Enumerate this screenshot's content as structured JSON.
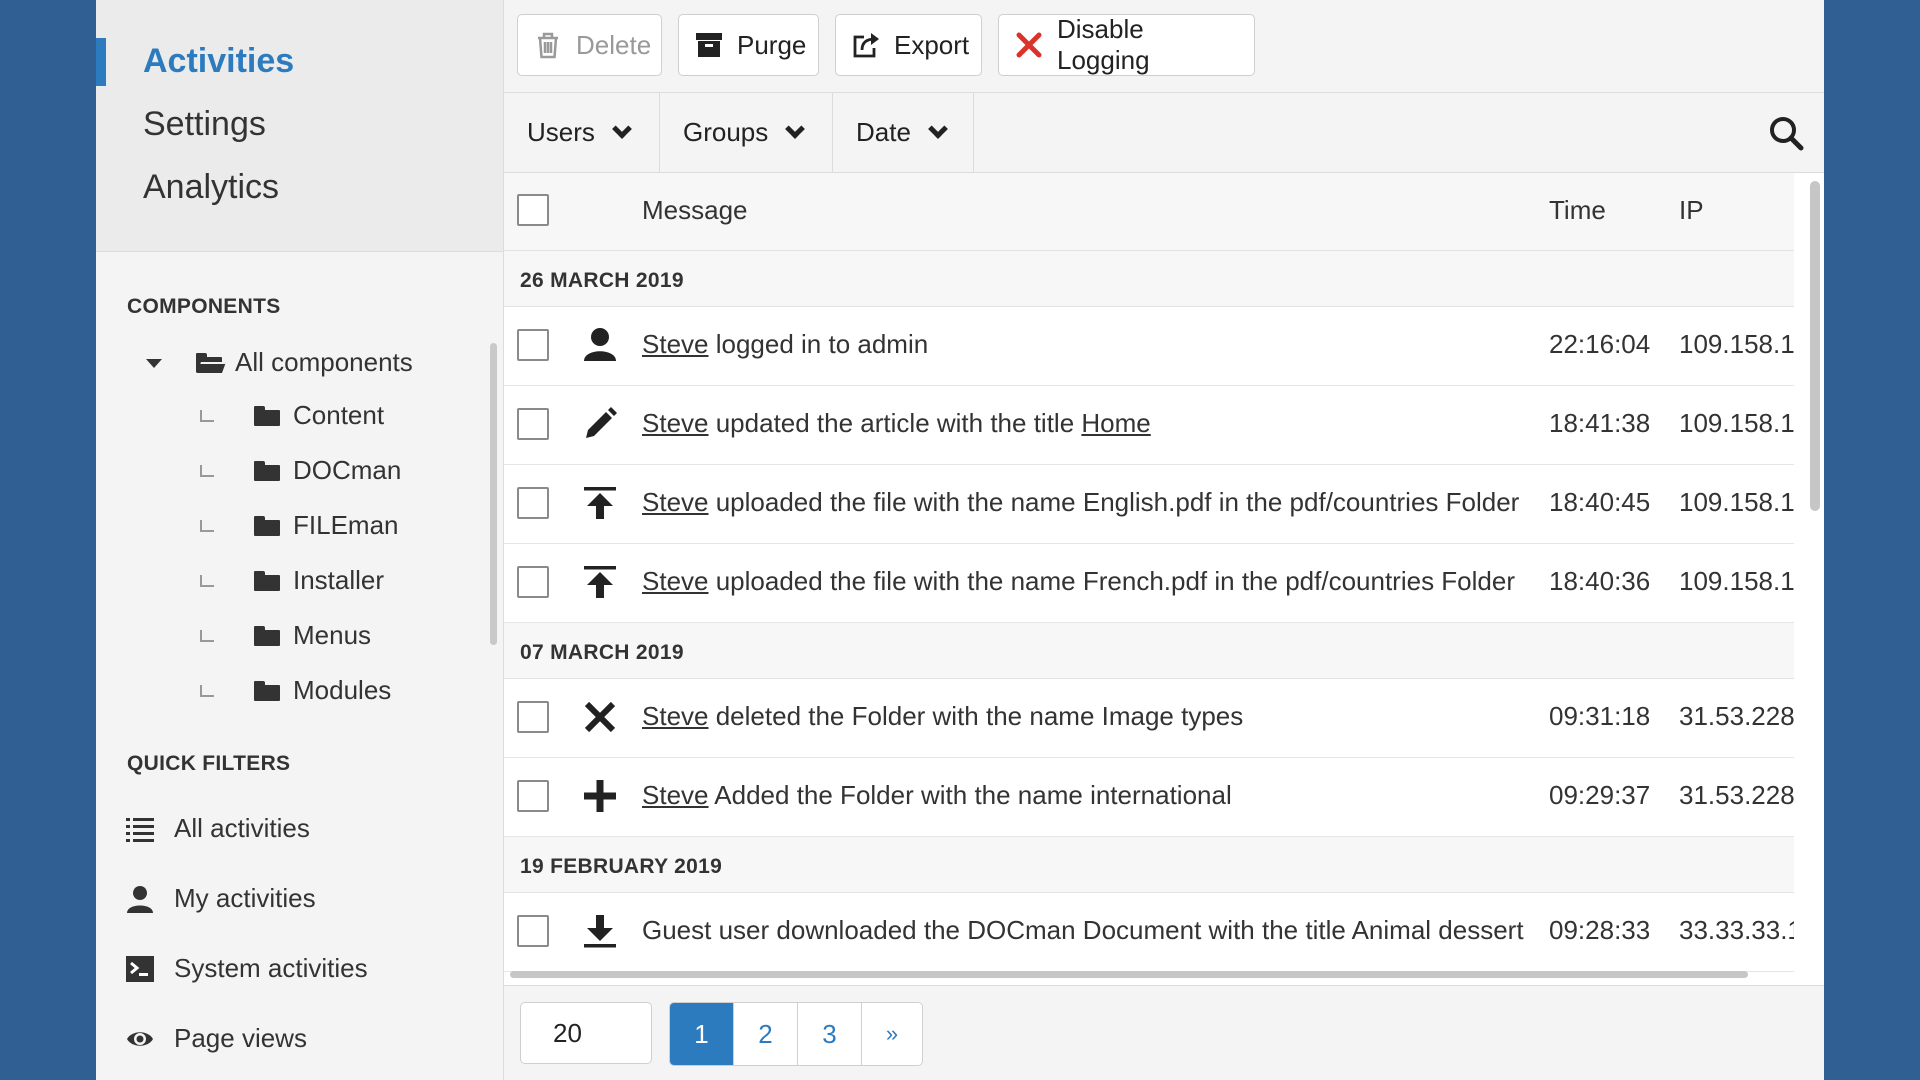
{
  "sidebar": {
    "main_nav": [
      {
        "label": "Activities",
        "active": true
      },
      {
        "label": "Settings",
        "active": false
      },
      {
        "label": "Analytics",
        "active": false
      }
    ],
    "components_heading": "COMPONENTS",
    "components_root": "All components",
    "components": [
      "Content",
      "DOCman",
      "FILEman",
      "Installer",
      "Menus",
      "Modules"
    ],
    "quick_filters_heading": "QUICK FILTERS",
    "quick_filters": [
      {
        "label": "All activities",
        "icon": "list-icon"
      },
      {
        "label": "My activities",
        "icon": "user-icon"
      },
      {
        "label": "System activities",
        "icon": "terminal-icon"
      },
      {
        "label": "Page views",
        "icon": "eye-icon"
      }
    ]
  },
  "toolbar": {
    "delete_label": "Delete",
    "purge_label": "Purge",
    "export_label": "Export",
    "disable_logging_label": "Disable Logging"
  },
  "filters": {
    "users_label": "Users",
    "groups_label": "Groups",
    "date_label": "Date"
  },
  "table": {
    "headers": {
      "message": "Message",
      "time": "Time",
      "ip": "IP"
    },
    "groups": [
      {
        "date": "26 MARCH 2019",
        "rows": [
          {
            "icon": "user-icon",
            "actor": "Steve",
            "text": " logged in to admin",
            "link": "",
            "time": "22:16:04",
            "ip": "109.158.1"
          },
          {
            "icon": "pencil-icon",
            "actor": "Steve",
            "text": " updated the article with the title ",
            "link": "Home",
            "time": "18:41:38",
            "ip": "109.158.1"
          },
          {
            "icon": "upload-icon",
            "actor": "Steve",
            "text": " uploaded the file with the name English.pdf in the pdf/countries Folder",
            "link": "",
            "time": "18:40:45",
            "ip": "109.158.1"
          },
          {
            "icon": "upload-icon",
            "actor": "Steve",
            "text": " uploaded the file with the name French.pdf in the pdf/countries Folder",
            "link": "",
            "time": "18:40:36",
            "ip": "109.158.1"
          }
        ]
      },
      {
        "date": "07 MARCH 2019",
        "rows": [
          {
            "icon": "x-icon",
            "actor": "Steve",
            "text": " deleted the Folder with the name Image types",
            "link": "",
            "time": "09:31:18",
            "ip": "31.53.228"
          },
          {
            "icon": "plus-icon",
            "actor": "Steve",
            "text": " Added the Folder with the name international",
            "link": "",
            "time": "09:29:37",
            "ip": "31.53.228"
          }
        ]
      },
      {
        "date": "19 FEBRUARY 2019",
        "rows": [
          {
            "icon": "download-icon",
            "actor": "",
            "text": "Guest user downloaded the DOCman Document with the title Animal dessert",
            "link": "",
            "time": "09:28:33",
            "ip": "33.33.33.1"
          }
        ]
      }
    ]
  },
  "pagination": {
    "per_page": "20",
    "pages": [
      "1",
      "2",
      "3",
      "»"
    ],
    "current": "1"
  },
  "colors": {
    "accent": "#2c7bbf",
    "background": "#2f5f93",
    "danger": "#d9342b"
  }
}
